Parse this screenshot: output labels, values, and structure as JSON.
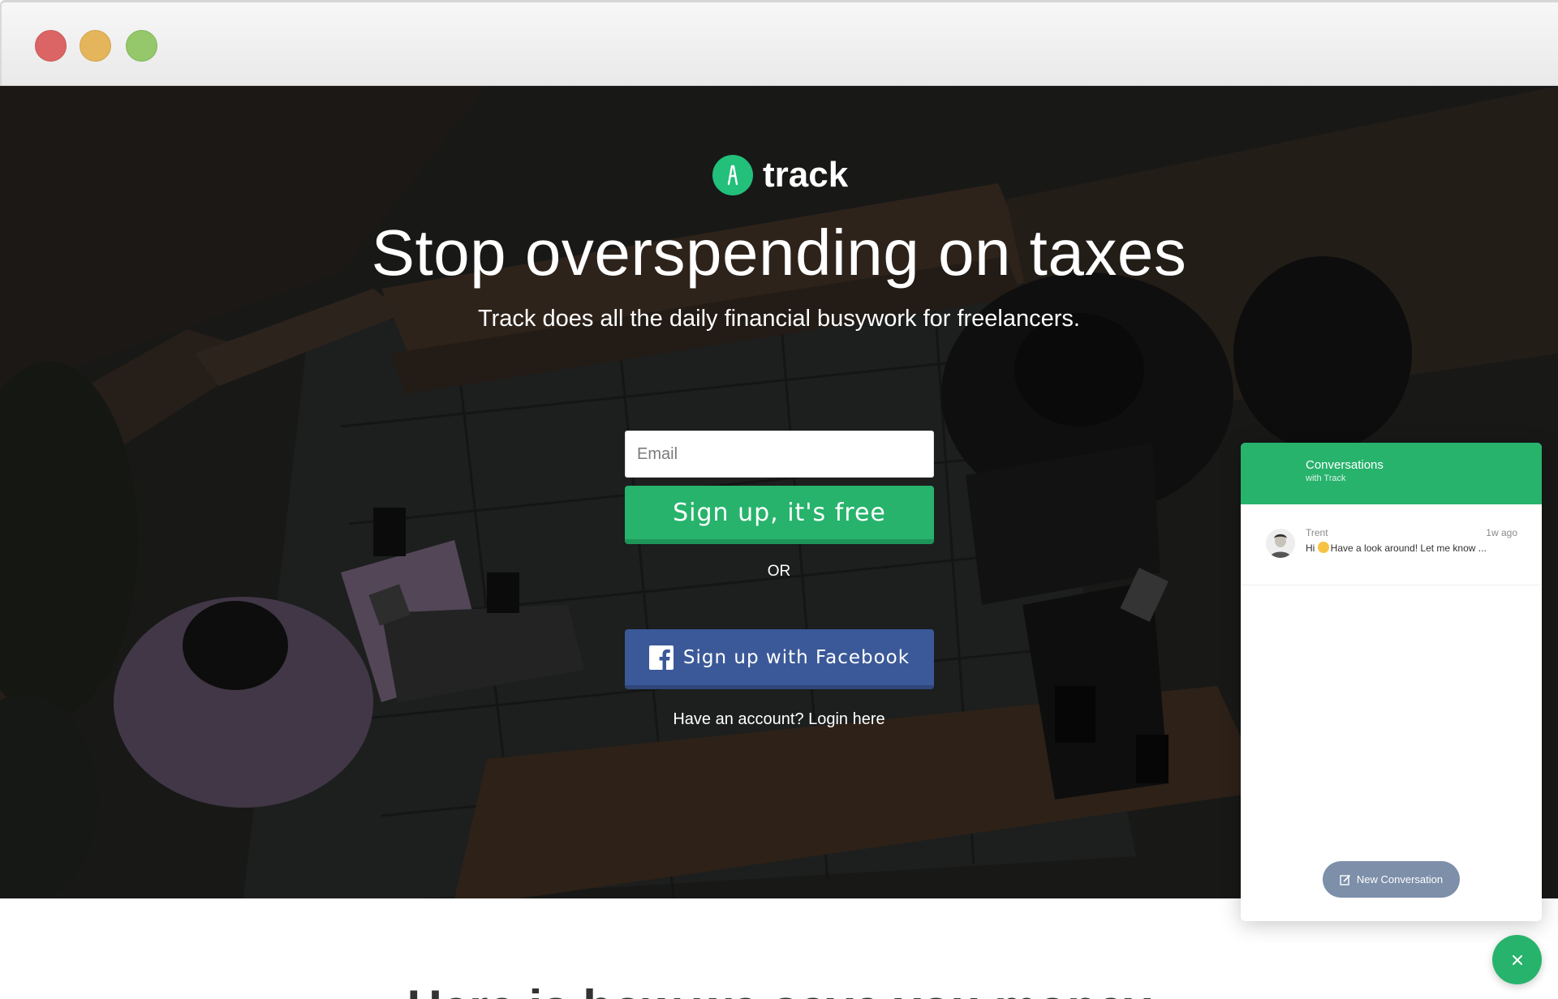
{
  "browser": {
    "controls": [
      "close",
      "minimize",
      "maximize"
    ]
  },
  "logo": {
    "text": "track",
    "icon": "track-logo-icon"
  },
  "hero": {
    "headline": "Stop overspending on taxes",
    "subhead": "Track does all the daily financial busywork for freelancers.",
    "email_placeholder": "Email",
    "email_value": "",
    "signup_label": "Sign up, it's free",
    "or_label": "OR",
    "facebook_label": "Sign up with Facebook",
    "login_label": "Have an account? Login here"
  },
  "below": {
    "heading": "Here is how we save you money"
  },
  "chat": {
    "title": "Conversations",
    "subtitle": "with Track",
    "conversations": [
      {
        "name": "Trent",
        "time": "1w ago",
        "message_before": "Hi ",
        "message_after": "Have a look around! Let me know ..."
      }
    ],
    "new_conversation_label": "New Conversation"
  },
  "colors": {
    "brand_green": "#27b36c",
    "facebook_blue": "#3b5998",
    "chat_button": "#7d8fa9"
  }
}
